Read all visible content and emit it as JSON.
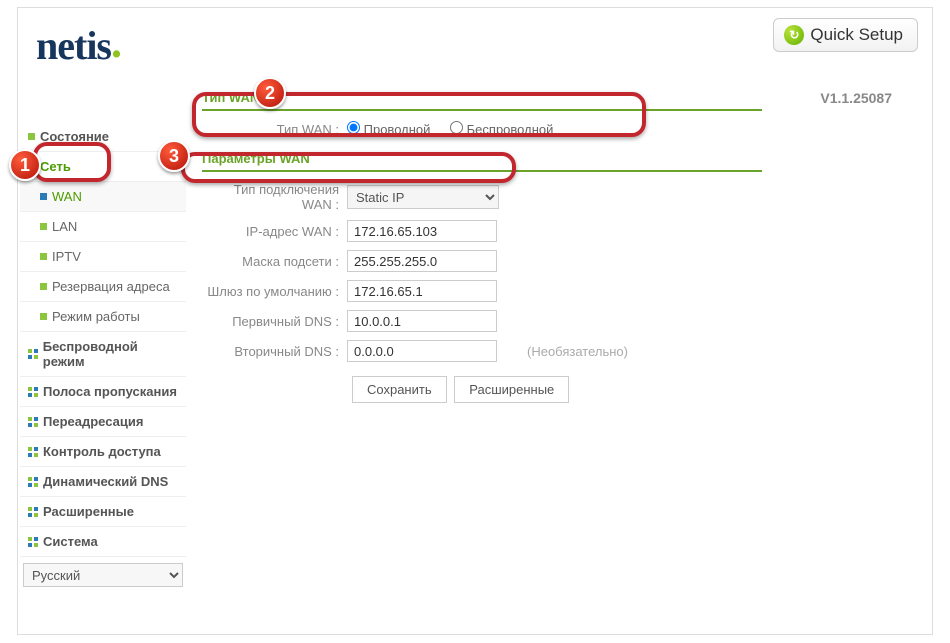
{
  "header": {
    "logo": "netis",
    "quick_setup": "Quick Setup",
    "version": "V1.1.25087"
  },
  "sidebar": {
    "status": "Состояние",
    "network": "Сеть",
    "wan": "WAN",
    "lan": "LAN",
    "iptv": "IPTV",
    "addr_res": "Резервация адреса",
    "op_mode": "Режим работы",
    "wireless": "Беспроводной режим",
    "bandwidth": "Полоса пропускания",
    "forwarding": "Переадресация",
    "access": "Контроль доступа",
    "ddns": "Динамический DNS",
    "advanced": "Расширенные",
    "system": "Система",
    "language": "Русский"
  },
  "main": {
    "section_type": "Тип WAN",
    "wan_type_label": "Тип WAN :",
    "wan_type_wired": "Проводной",
    "wan_type_wireless": "Беспроводной",
    "section_params": "Параметры WAN",
    "conn_type_label": "Тип подключения WAN :",
    "conn_type_value": "Static IP",
    "ip_label": "IP-адрес WAN :",
    "ip_value": "172.16.65.103",
    "mask_label": "Маска подсети :",
    "mask_value": "255.255.255.0",
    "gw_label": "Шлюз по умолчанию :",
    "gw_value": "172.16.65.1",
    "dns1_label": "Первичный DNS :",
    "dns1_value": "10.0.0.1",
    "dns2_label": "Вторичный DNS :",
    "dns2_value": "0.0.0.0",
    "dns2_hint": "(Необязательно)",
    "btn_save": "Сохранить",
    "btn_adv": "Расширенные"
  },
  "annotations": {
    "b1": "1",
    "b2": "2",
    "b3": "3"
  }
}
